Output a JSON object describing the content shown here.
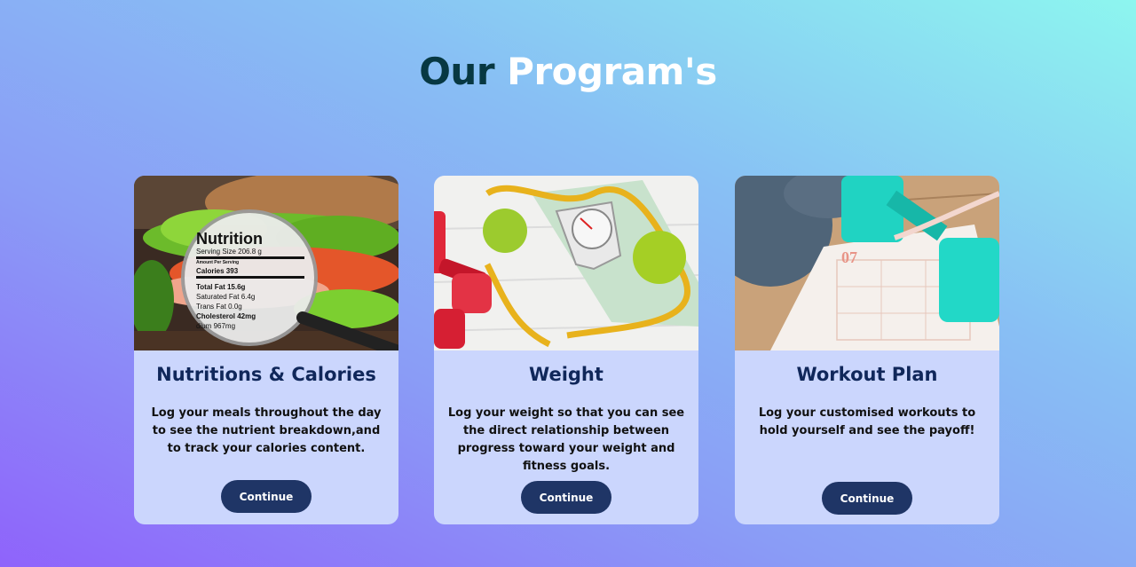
{
  "heading": {
    "part1": "Our",
    "part2": "Program's"
  },
  "cards": [
    {
      "title": "Nutritions & Calories",
      "description": "Log your meals throughout the day to see the nutrient breakdown,and to track your calories content.",
      "button": "Continue",
      "image_label": {
        "title": "Nutrition",
        "serving": "Serving Size 206.8 g",
        "amount": "Amount Per Serving",
        "calories": "Calories 393",
        "total_fat": "Total Fat 15.6g",
        "sat_fat": "Saturated Fat 6.4g",
        "trans_fat": "Trans Fat 0.0g",
        "cholesterol": "Cholesterol 42mg",
        "sodium": "dium 967mg"
      }
    },
    {
      "title": "Weight",
      "description": "Log your weight so that you can see the direct relationship between progress toward your weight and fitness goals.",
      "button": "Continue"
    },
    {
      "title": "Workout Plan",
      "description": "Log your customised workouts to hold yourself and see the payoff!",
      "button": "Continue",
      "image_label": {
        "calendar_number": "07"
      }
    }
  ]
}
